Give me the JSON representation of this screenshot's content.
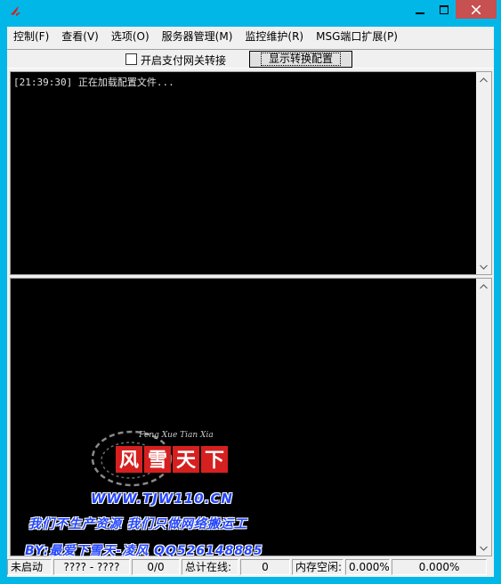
{
  "window": {
    "buttons": {
      "minimize": "minimize-icon",
      "maximize": "maximize-icon",
      "close": "close-icon"
    }
  },
  "menu": [
    {
      "label": "控制(F)"
    },
    {
      "label": "查看(V)"
    },
    {
      "label": "选项(O)"
    },
    {
      "label": "服务器管理(M)"
    },
    {
      "label": "监控维护(R)"
    },
    {
      "label": "MSG端口扩展(P)"
    }
  ],
  "toolbar": {
    "checkbox_label": "开启支付网关转接",
    "checkbox_checked": false,
    "config_button": "显示转换配置"
  },
  "log": {
    "lines": [
      "[21:39:30] 正在加载配置文件..."
    ]
  },
  "banner": {
    "logo_text": "风雪天下",
    "logo_subtext": "Feng Xue Tian Xia",
    "url": "WWW.TJW110.CN",
    "slogan": "我们不生产资源   我们只做网络搬运工",
    "by_line": "BY:最爱下雪天-凌风 QQ526148885"
  },
  "status": {
    "state": "未启动",
    "range": "???? - ????",
    "count": "0/0",
    "online_label": "总计在线:",
    "online_value": "0",
    "mem_label": "内存空闲:",
    "mem_value": "0.000%",
    "extra_value": "0.000%"
  },
  "colors": {
    "titlebar": "#00b7e8",
    "close_button": "#c75050",
    "banner_text": "#2446ff",
    "logo_red": "#d62020"
  }
}
